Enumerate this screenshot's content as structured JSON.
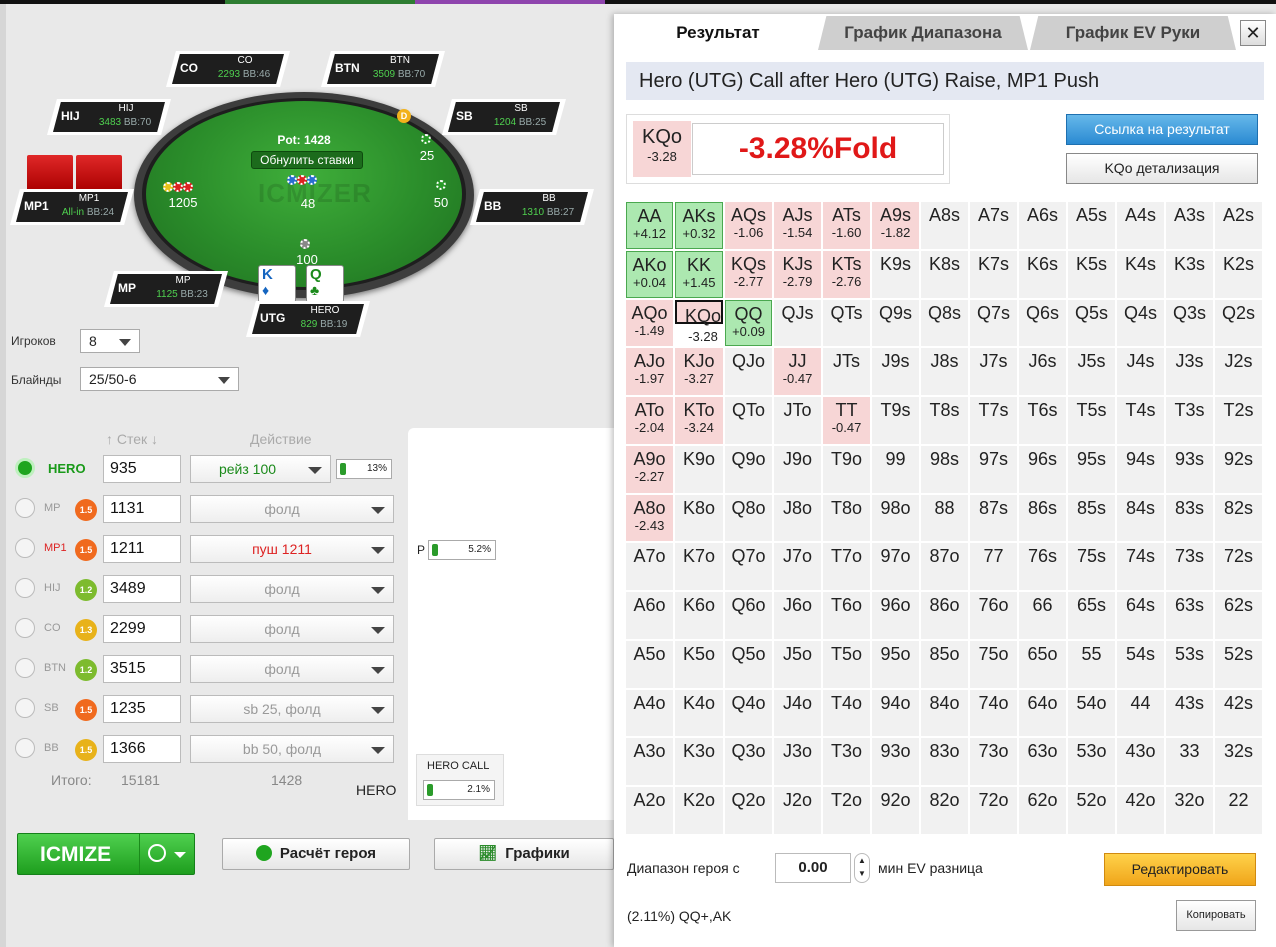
{
  "table": {
    "pot_label": "Pot: 1428",
    "reset_label": "Обнулить ставки",
    "watermark": "ICMIZER",
    "center_chips": "48",
    "chips": {
      "utg": "100",
      "mp1": "1205",
      "sb": "25",
      "bb": "50"
    },
    "dealer": "D",
    "hero_cards": [
      {
        "rank": "K",
        "suit": "♦",
        "color": "#1565c0"
      },
      {
        "rank": "Q",
        "suit": "♣",
        "color": "#1b8a1b"
      }
    ],
    "seats": [
      {
        "pos": "CO",
        "name": "CO",
        "stack": "2293",
        "bb": "BB:46"
      },
      {
        "pos": "BTN",
        "name": "BTN",
        "stack": "3509",
        "bb": "BB:70"
      },
      {
        "pos": "HIJ",
        "name": "HIJ",
        "stack": "3483",
        "bb": "BB:70"
      },
      {
        "pos": "SB",
        "name": "SB",
        "stack": "1204",
        "bb": "BB:25"
      },
      {
        "pos": "MP1",
        "name": "MP1",
        "stack": "All-in",
        "bb": "BB:24"
      },
      {
        "pos": "BB",
        "name": "BB",
        "stack": "1310",
        "bb": "BB:27"
      },
      {
        "pos": "MP",
        "name": "MP",
        "stack": "1125",
        "bb": "BB:23"
      },
      {
        "pos": "UTG",
        "name": "HERO",
        "stack": "829",
        "bb": "BB:19"
      }
    ]
  },
  "settings": {
    "players_label": "Игроков",
    "players_value": "8",
    "blinds_label": "Блайнды",
    "blinds_value": "25/50-6"
  },
  "players_header": {
    "stack": "Стек",
    "action": "Действие"
  },
  "players": [
    {
      "name": "HERO",
      "badge": "",
      "stack": "935",
      "action": "рейз 100",
      "pct": "13%"
    },
    {
      "name": "MP",
      "badge": "1.5",
      "stack": "1131",
      "action": "фолд",
      "pct": ""
    },
    {
      "name": "MP1",
      "badge": "1.5",
      "stack": "1211",
      "action": "пуш 1211",
      "pct": ""
    },
    {
      "name": "HIJ",
      "badge": "1.2",
      "stack": "3489",
      "action": "фолд",
      "pct": ""
    },
    {
      "name": "CO",
      "badge": "1.3",
      "stack": "2299",
      "action": "фолд",
      "pct": ""
    },
    {
      "name": "BTN",
      "badge": "1.2",
      "stack": "3515",
      "action": "фолд",
      "pct": ""
    },
    {
      "name": "SB",
      "badge": "1.5",
      "stack": "1235",
      "action": "sb 25, фолд",
      "pct": ""
    },
    {
      "name": "BB",
      "badge": "1.5",
      "stack": "1366",
      "action": "bb 50, фолд",
      "pct": ""
    }
  ],
  "colors": {
    "badge_orange": "#f06a1e",
    "badge_green": "#7dbb2e",
    "badge_yellow": "#e8b21a",
    "accent_green": "#2bb52b"
  },
  "totals": {
    "label": "Итого:",
    "stack": "15181",
    "action": "1428"
  },
  "tree": {
    "p_label": "P",
    "p_pct": "5.2%",
    "node_label": "HERO CALL",
    "node_pct": "2.1%",
    "hero_label": "HERO"
  },
  "buttons": {
    "icmize": "ICMIZE",
    "hero_calc": "Расчёт героя",
    "charts": "Графики"
  },
  "panel": {
    "tabs": [
      "Результат",
      "График Диапазона",
      "График EV Руки"
    ],
    "close": "✕",
    "title": "Hero (UTG) Call after Hero (UTG) Raise, MP1 Push",
    "hand": "KQo",
    "hand_ev": "-3.28",
    "result": "-3.28%Fold",
    "link_btn": "Ссылка на результат",
    "detail_btn": "KQo детализация",
    "range_label": "Диапазон героя с",
    "range_value": "0.00",
    "range_suffix": "мин EV разница",
    "edit_btn": "Редактировать",
    "summary": "(2.11%) QQ+,AK",
    "copy_btn": "Копировать"
  },
  "matrix": [
    [
      [
        "AA",
        "+4.12"
      ],
      [
        "AKs",
        "+0.32"
      ],
      [
        "AQs",
        "-1.06"
      ],
      [
        "AJs",
        "-1.54"
      ],
      [
        "ATs",
        "-1.60"
      ],
      [
        "A9s",
        "-1.82"
      ],
      [
        "A8s",
        ""
      ],
      [
        "A7s",
        ""
      ],
      [
        "A6s",
        ""
      ],
      [
        "A5s",
        ""
      ],
      [
        "A4s",
        ""
      ],
      [
        "A3s",
        ""
      ],
      [
        "A2s",
        ""
      ]
    ],
    [
      [
        "AKo",
        "+0.04"
      ],
      [
        "KK",
        "+1.45"
      ],
      [
        "KQs",
        "-2.77"
      ],
      [
        "KJs",
        "-2.79"
      ],
      [
        "KTs",
        "-2.76"
      ],
      [
        "K9s",
        ""
      ],
      [
        "K8s",
        ""
      ],
      [
        "K7s",
        ""
      ],
      [
        "K6s",
        ""
      ],
      [
        "K5s",
        ""
      ],
      [
        "K4s",
        ""
      ],
      [
        "K3s",
        ""
      ],
      [
        "K2s",
        ""
      ]
    ],
    [
      [
        "AQo",
        "-1.49"
      ],
      [
        "KQo",
        "-3.28"
      ],
      [
        "QQ",
        "+0.09"
      ],
      [
        "QJs",
        ""
      ],
      [
        "QTs",
        ""
      ],
      [
        "Q9s",
        ""
      ],
      [
        "Q8s",
        ""
      ],
      [
        "Q7s",
        ""
      ],
      [
        "Q6s",
        ""
      ],
      [
        "Q5s",
        ""
      ],
      [
        "Q4s",
        ""
      ],
      [
        "Q3s",
        ""
      ],
      [
        "Q2s",
        ""
      ]
    ],
    [
      [
        "AJo",
        "-1.97"
      ],
      [
        "KJo",
        "-3.27"
      ],
      [
        "QJo",
        ""
      ],
      [
        "JJ",
        "-0.47"
      ],
      [
        "JTs",
        ""
      ],
      [
        "J9s",
        ""
      ],
      [
        "J8s",
        ""
      ],
      [
        "J7s",
        ""
      ],
      [
        "J6s",
        ""
      ],
      [
        "J5s",
        ""
      ],
      [
        "J4s",
        ""
      ],
      [
        "J3s",
        ""
      ],
      [
        "J2s",
        ""
      ]
    ],
    [
      [
        "ATo",
        "-2.04"
      ],
      [
        "KTo",
        "-3.24"
      ],
      [
        "QTo",
        ""
      ],
      [
        "JTo",
        ""
      ],
      [
        "TT",
        "-0.47"
      ],
      [
        "T9s",
        ""
      ],
      [
        "T8s",
        ""
      ],
      [
        "T7s",
        ""
      ],
      [
        "T6s",
        ""
      ],
      [
        "T5s",
        ""
      ],
      [
        "T4s",
        ""
      ],
      [
        "T3s",
        ""
      ],
      [
        "T2s",
        ""
      ]
    ],
    [
      [
        "A9o",
        "-2.27"
      ],
      [
        "K9o",
        ""
      ],
      [
        "Q9o",
        ""
      ],
      [
        "J9o",
        ""
      ],
      [
        "T9o",
        ""
      ],
      [
        "99",
        ""
      ],
      [
        "98s",
        ""
      ],
      [
        "97s",
        ""
      ],
      [
        "96s",
        ""
      ],
      [
        "95s",
        ""
      ],
      [
        "94s",
        ""
      ],
      [
        "93s",
        ""
      ],
      [
        "92s",
        ""
      ]
    ],
    [
      [
        "A8o",
        "-2.43"
      ],
      [
        "K8o",
        ""
      ],
      [
        "Q8o",
        ""
      ],
      [
        "J8o",
        ""
      ],
      [
        "T8o",
        ""
      ],
      [
        "98o",
        ""
      ],
      [
        "88",
        ""
      ],
      [
        "87s",
        ""
      ],
      [
        "86s",
        ""
      ],
      [
        "85s",
        ""
      ],
      [
        "84s",
        ""
      ],
      [
        "83s",
        ""
      ],
      [
        "82s",
        ""
      ]
    ],
    [
      [
        "A7o",
        ""
      ],
      [
        "K7o",
        ""
      ],
      [
        "Q7o",
        ""
      ],
      [
        "J7o",
        ""
      ],
      [
        "T7o",
        ""
      ],
      [
        "97o",
        ""
      ],
      [
        "87o",
        ""
      ],
      [
        "77",
        ""
      ],
      [
        "76s",
        ""
      ],
      [
        "75s",
        ""
      ],
      [
        "74s",
        ""
      ],
      [
        "73s",
        ""
      ],
      [
        "72s",
        ""
      ]
    ],
    [
      [
        "A6o",
        ""
      ],
      [
        "K6o",
        ""
      ],
      [
        "Q6o",
        ""
      ],
      [
        "J6o",
        ""
      ],
      [
        "T6o",
        ""
      ],
      [
        "96o",
        ""
      ],
      [
        "86o",
        ""
      ],
      [
        "76o",
        ""
      ],
      [
        "66",
        ""
      ],
      [
        "65s",
        ""
      ],
      [
        "64s",
        ""
      ],
      [
        "63s",
        ""
      ],
      [
        "62s",
        ""
      ]
    ],
    [
      [
        "A5o",
        ""
      ],
      [
        "K5o",
        ""
      ],
      [
        "Q5o",
        ""
      ],
      [
        "J5o",
        ""
      ],
      [
        "T5o",
        ""
      ],
      [
        "95o",
        ""
      ],
      [
        "85o",
        ""
      ],
      [
        "75o",
        ""
      ],
      [
        "65o",
        ""
      ],
      [
        "55",
        ""
      ],
      [
        "54s",
        ""
      ],
      [
        "53s",
        ""
      ],
      [
        "52s",
        ""
      ]
    ],
    [
      [
        "A4o",
        ""
      ],
      [
        "K4o",
        ""
      ],
      [
        "Q4o",
        ""
      ],
      [
        "J4o",
        ""
      ],
      [
        "T4o",
        ""
      ],
      [
        "94o",
        ""
      ],
      [
        "84o",
        ""
      ],
      [
        "74o",
        ""
      ],
      [
        "64o",
        ""
      ],
      [
        "54o",
        ""
      ],
      [
        "44",
        ""
      ],
      [
        "43s",
        ""
      ],
      [
        "42s",
        ""
      ]
    ],
    [
      [
        "A3o",
        ""
      ],
      [
        "K3o",
        ""
      ],
      [
        "Q3o",
        ""
      ],
      [
        "J3o",
        ""
      ],
      [
        "T3o",
        ""
      ],
      [
        "93o",
        ""
      ],
      [
        "83o",
        ""
      ],
      [
        "73o",
        ""
      ],
      [
        "63o",
        ""
      ],
      [
        "53o",
        ""
      ],
      [
        "43o",
        ""
      ],
      [
        "33",
        ""
      ],
      [
        "32s",
        ""
      ]
    ],
    [
      [
        "A2o",
        ""
      ],
      [
        "K2o",
        ""
      ],
      [
        "Q2o",
        ""
      ],
      [
        "J2o",
        ""
      ],
      [
        "T2o",
        ""
      ],
      [
        "92o",
        ""
      ],
      [
        "82o",
        ""
      ],
      [
        "72o",
        ""
      ],
      [
        "62o",
        ""
      ],
      [
        "52o",
        ""
      ],
      [
        "42o",
        ""
      ],
      [
        "32o",
        ""
      ],
      [
        "22",
        ""
      ]
    ]
  ]
}
